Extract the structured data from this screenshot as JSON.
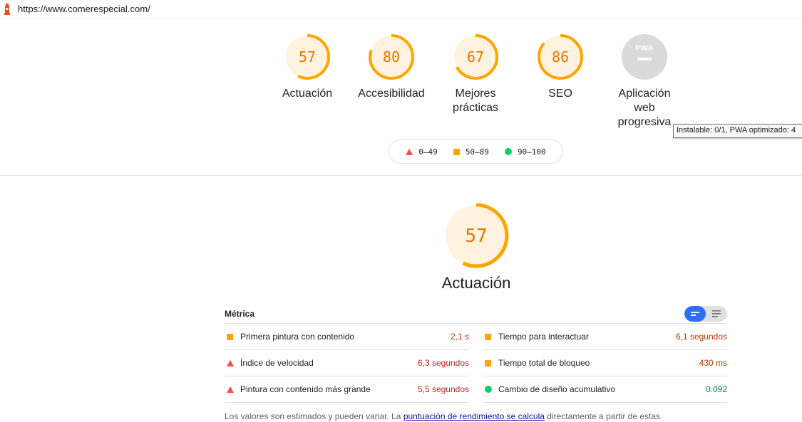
{
  "browser": {
    "url": "https://www.comerespecial.com/"
  },
  "categories": [
    {
      "score": "57",
      "label": "Actuación",
      "fraction": 0.57
    },
    {
      "score": "80",
      "label": "Accesibilidad",
      "fraction": 0.8
    },
    {
      "score": "67",
      "label": "Mejores prácticas",
      "fraction": 0.67
    },
    {
      "score": "86",
      "label": "SEO",
      "fraction": 0.86
    },
    {
      "score": "",
      "label": "Aplicación web progresiva",
      "badge_text": "PWA"
    }
  ],
  "tooltip": "Instalable: 0/1, PWA optimizado: 4",
  "legend": {
    "fail": "0–49",
    "average": "50–89",
    "pass": "90–100"
  },
  "performance": {
    "score": "57",
    "fraction": 0.57,
    "title": "Actuación"
  },
  "metrics": {
    "title": "Métrica",
    "left": [
      {
        "name": "Primera pintura con contenido",
        "value": "2,1 s",
        "status": "average"
      },
      {
        "name": "Índice de velocidad",
        "value": "6,3 segundos",
        "status": "fail"
      },
      {
        "name": "Pintura con contenido más grande",
        "value": "5,5 segundos",
        "status": "fail"
      }
    ],
    "right": [
      {
        "name": "Tiempo para interactuar",
        "value": "6,1 segundos",
        "status": "average"
      },
      {
        "name": "Tiempo total de bloqueo",
        "value": "430 ms",
        "status": "average"
      },
      {
        "name": "Cambio de diseño acumulativo",
        "value": "0.092",
        "status": "pass"
      }
    ]
  },
  "footnote": {
    "before": "Los valores son estimados y pueden variar. La ",
    "link": "puntuación de rendimiento se calcula",
    "after": " directamente a partir de estas"
  },
  "colors": {
    "average": "#ffa400",
    "fail": "#ff4e42",
    "pass": "#0cce6b",
    "toggle": "#2a6ff5"
  }
}
